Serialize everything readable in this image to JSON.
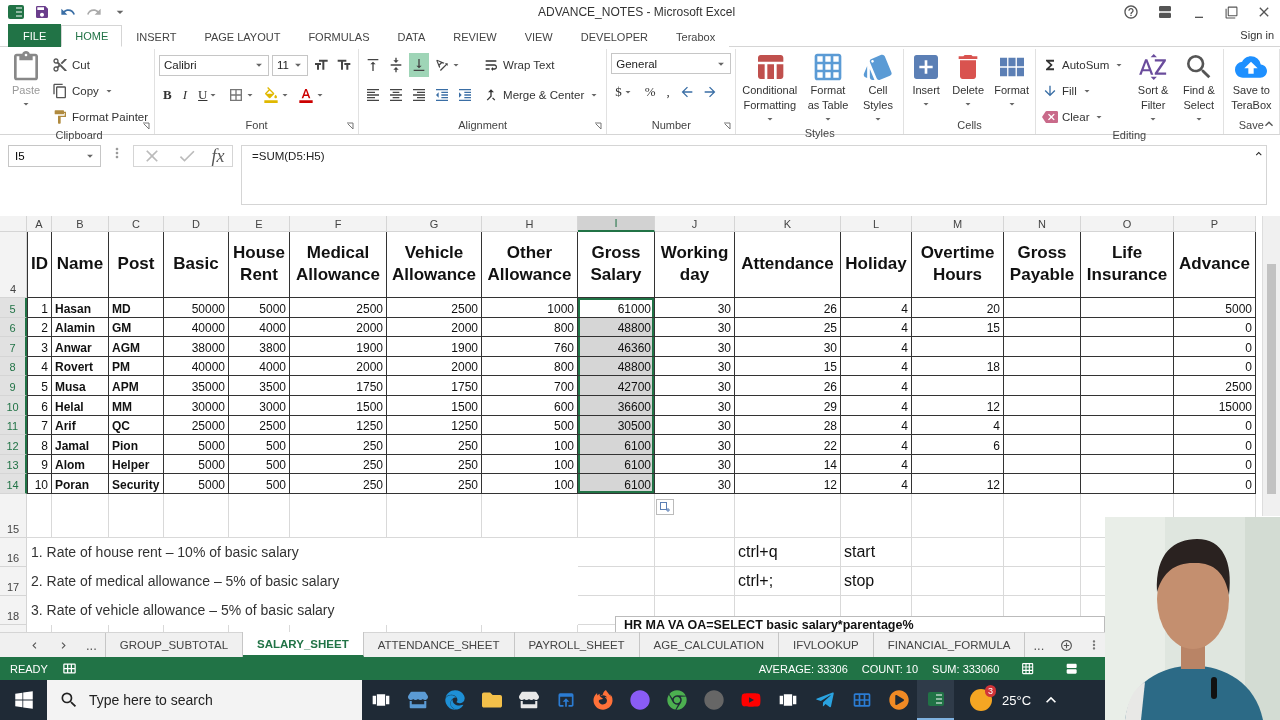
{
  "window": {
    "title": "ADVANCE_NOTES - Microsoft Excel",
    "sign_in": "Sign in"
  },
  "tabs": [
    {
      "label": "FILE",
      "selected": false,
      "kind": "file"
    },
    {
      "label": "HOME",
      "selected": true,
      "kind": "tab"
    },
    {
      "label": "INSERT",
      "selected": false,
      "kind": "tab"
    },
    {
      "label": "PAGE LAYOUT",
      "selected": false,
      "kind": "tab"
    },
    {
      "label": "FORMULAS",
      "selected": false,
      "kind": "tab"
    },
    {
      "label": "DATA",
      "selected": false,
      "kind": "tab"
    },
    {
      "label": "REVIEW",
      "selected": false,
      "kind": "tab"
    },
    {
      "label": "VIEW",
      "selected": false,
      "kind": "tab"
    },
    {
      "label": "DEVELOPER",
      "selected": false,
      "kind": "tab"
    },
    {
      "label": "Terabox",
      "selected": false,
      "kind": "tab"
    }
  ],
  "ribbon": [
    {
      "label": "Clipboard",
      "launcher": true,
      "columns": [
        [
          [
            {
              "kind": "large",
              "label": "Paste",
              "dropdown": true,
              "disabled": true
            }
          ]
        ],
        [
          [
            {
              "kind": "small",
              "label": "Cut"
            }
          ],
          [
            {
              "kind": "small",
              "label": "Copy",
              "dropdown": true
            }
          ],
          [
            {
              "kind": "small",
              "label": "Format Painter"
            }
          ]
        ]
      ]
    },
    {
      "label": "Font",
      "launcher": true,
      "columns": [
        [
          [
            {
              "kind": "field",
              "value": "Calibri"
            },
            {
              "kind": "field",
              "value": "11"
            },
            {
              "kind": "icon"
            },
            {
              "kind": "icon"
            }
          ],
          [
            {
              "kind": "glyph",
              "label": "B"
            },
            {
              "kind": "glyph",
              "label": "I"
            },
            {
              "kind": "glyph",
              "label": "U",
              "dropdown": true
            },
            {
              "kind": "icon",
              "dropdown": true
            },
            {
              "kind": "icon",
              "dropdown": true
            },
            {
              "kind": "icon",
              "dropdown": true
            }
          ]
        ]
      ]
    },
    {
      "label": "Alignment",
      "launcher": true,
      "columns": [
        [
          [
            {
              "kind": "icon",
              "selected": false
            },
            {
              "kind": "icon",
              "selected": false
            },
            {
              "kind": "icon",
              "selected": true
            },
            {
              "kind": "icon",
              "dropdown": true
            }
          ],
          [
            {
              "kind": "icon"
            },
            {
              "kind": "icon"
            },
            {
              "kind": "icon"
            },
            {
              "kind": "icon"
            },
            {
              "kind": "icon"
            }
          ]
        ],
        [
          [
            {
              "kind": "small",
              "label": "Wrap Text"
            }
          ],
          [
            {
              "kind": "small",
              "label": "Merge & Center",
              "dropdown": true
            }
          ]
        ]
      ]
    },
    {
      "label": "Number",
      "launcher": true,
      "columns": [
        [
          [
            {
              "kind": "field",
              "value": "General"
            }
          ],
          [
            {
              "kind": "glyph",
              "label": "$",
              "dropdown": true
            },
            {
              "kind": "glyph",
              "label": "%"
            },
            {
              "kind": "glyph",
              "label": ","
            },
            {
              "kind": "icon"
            },
            {
              "kind": "icon"
            }
          ]
        ]
      ]
    },
    {
      "label": "Styles",
      "launcher": false,
      "columns": [
        [
          [
            {
              "kind": "large",
              "label": "Conditional Formatting",
              "dropdown": true
            }
          ]
        ],
        [
          [
            {
              "kind": "large",
              "label": "Format as Table",
              "dropdown": true
            }
          ]
        ],
        [
          [
            {
              "kind": "large",
              "label": "Cell Styles",
              "dropdown": true
            }
          ]
        ]
      ]
    },
    {
      "label": "Cells",
      "launcher": false,
      "columns": [
        [
          [
            {
              "kind": "large",
              "label": "Insert",
              "dropdown": true
            }
          ]
        ],
        [
          [
            {
              "kind": "large",
              "label": "Delete",
              "dropdown": true
            }
          ]
        ],
        [
          [
            {
              "kind": "large",
              "label": "Format",
              "dropdown": true
            }
          ]
        ]
      ]
    },
    {
      "label": "Editing",
      "launcher": false,
      "columns": [
        [
          [
            {
              "kind": "small",
              "label": "AutoSum",
              "dropdown": true
            }
          ],
          [
            {
              "kind": "small",
              "label": "Fill",
              "dropdown": true
            }
          ],
          [
            {
              "kind": "small",
              "label": "Clear",
              "dropdown": true
            }
          ]
        ],
        [
          [
            {
              "kind": "large",
              "label": "Sort & Filter",
              "dropdown": true
            }
          ]
        ],
        [
          [
            {
              "kind": "large",
              "label": "Find & Select",
              "dropdown": true
            }
          ]
        ]
      ]
    },
    {
      "label": "Save",
      "launcher": false,
      "columns": [
        [
          [
            {
              "kind": "large",
              "label": "Save to TeraBox"
            }
          ]
        ]
      ]
    }
  ],
  "formula_bar": {
    "name_box": "I5",
    "function_label": "fx",
    "formula": "=SUM(D5:H5)"
  },
  "sheet": {
    "columns": [
      {
        "letter": "A",
        "selected": false,
        "kind": "number"
      },
      {
        "letter": "B",
        "selected": false,
        "kind": "label"
      },
      {
        "letter": "C",
        "selected": false,
        "kind": "label"
      },
      {
        "letter": "D",
        "selected": false,
        "kind": "number"
      },
      {
        "letter": "E",
        "selected": false,
        "kind": "number"
      },
      {
        "letter": "F",
        "selected": false,
        "kind": "number"
      },
      {
        "letter": "G",
        "selected": false,
        "kind": "number"
      },
      {
        "letter": "H",
        "selected": false,
        "kind": "number"
      },
      {
        "letter": "I",
        "selected": true,
        "kind": "number"
      },
      {
        "letter": "J",
        "selected": false,
        "kind": "number"
      },
      {
        "letter": "K",
        "selected": false,
        "kind": "number"
      },
      {
        "letter": "L",
        "selected": false,
        "kind": "number"
      },
      {
        "letter": "M",
        "selected": false,
        "kind": "number"
      },
      {
        "letter": "N",
        "selected": false,
        "kind": "number"
      },
      {
        "letter": "O",
        "selected": false,
        "kind": "number"
      },
      {
        "letter": "P",
        "selected": false,
        "kind": "number"
      }
    ],
    "header_row": {
      "row": "4",
      "cells": [
        "ID",
        "Name",
        "Post",
        "Basic",
        "House Rent",
        "Medical Allowance",
        "Vehicle Allowance",
        "Other Allowance",
        "Gross Salary",
        "Working day",
        "Attendance",
        "Holiday",
        "Overtime Hours",
        "Gross Payable",
        "Life Insurance",
        "Advance"
      ]
    },
    "rows": [
      {
        "row": "5",
        "selected": true,
        "active": true,
        "cells": [
          "1",
          "Hasan",
          "MD",
          "50000",
          "5000",
          "2500",
          "2500",
          "1000",
          "61000",
          "30",
          "26",
          "4",
          "20",
          null,
          null,
          "5000"
        ]
      },
      {
        "row": "6",
        "selected": true,
        "active": false,
        "cells": [
          "2",
          "Alamin",
          "GM",
          "40000",
          "4000",
          "2000",
          "2000",
          "800",
          "48800",
          "30",
          "25",
          "4",
          "15",
          null,
          null,
          "0"
        ]
      },
      {
        "row": "7",
        "selected": true,
        "active": false,
        "cells": [
          "3",
          "Anwar",
          "AGM",
          "38000",
          "3800",
          "1900",
          "1900",
          "760",
          "46360",
          "30",
          "30",
          "4",
          null,
          null,
          null,
          "0"
        ]
      },
      {
        "row": "8",
        "selected": true,
        "active": false,
        "cells": [
          "4",
          "Rovert",
          "PM",
          "40000",
          "4000",
          "2000",
          "2000",
          "800",
          "48800",
          "30",
          "15",
          "4",
          "18",
          null,
          null,
          "0"
        ]
      },
      {
        "row": "9",
        "selected": true,
        "active": false,
        "cells": [
          "5",
          "Musa",
          "APM",
          "35000",
          "3500",
          "1750",
          "1750",
          "700",
          "42700",
          "30",
          "26",
          "4",
          null,
          null,
          null,
          "2500"
        ]
      },
      {
        "row": "10",
        "selected": true,
        "active": false,
        "cells": [
          "6",
          "Helal",
          "MM",
          "30000",
          "3000",
          "1500",
          "1500",
          "600",
          "36600",
          "30",
          "29",
          "4",
          "12",
          null,
          null,
          "15000"
        ]
      },
      {
        "row": "11",
        "selected": true,
        "active": false,
        "cells": [
          "7",
          "Arif",
          "QC",
          "25000",
          "2500",
          "1250",
          "1250",
          "500",
          "30500",
          "30",
          "28",
          "4",
          "4",
          null,
          null,
          "0"
        ]
      },
      {
        "row": "12",
        "selected": true,
        "active": false,
        "cells": [
          "8",
          "Jamal",
          "Pion",
          "5000",
          "500",
          "250",
          "250",
          "100",
          "6100",
          "30",
          "22",
          "4",
          "6",
          null,
          null,
          "0"
        ]
      },
      {
        "row": "13",
        "selected": true,
        "active": false,
        "cells": [
          "9",
          "Alom",
          "Helper",
          "5000",
          "500",
          "250",
          "250",
          "100",
          "6100",
          "30",
          "14",
          "4",
          null,
          null,
          null,
          "0"
        ]
      },
      {
        "row": "14",
        "selected": true,
        "active": false,
        "cells": [
          "10",
          "Poran",
          "Security",
          "5000",
          "500",
          "250",
          "250",
          "100",
          "6100",
          "30",
          "12",
          "4",
          "12",
          null,
          null,
          "0"
        ]
      }
    ],
    "empty_row": "15",
    "note_rows": [
      {
        "row": "16",
        "note": "1.  Rate of house rent – 10% of basic salary",
        "shortcut": "ctrl+q",
        "action": "start"
      },
      {
        "row": "17",
        "note": "2.  Rate of medical allowance – 5% of basic salary",
        "shortcut": "ctrl+;",
        "action": "stop"
      },
      {
        "row": "18",
        "note": "3.  Rate of vehicle allowance – 5% of basic salary"
      }
    ],
    "text_box": "HR MA VA OA=SELECT basic salary*parentage%"
  },
  "sheet_tabs": {
    "more_left": "...",
    "tabs": [
      {
        "label": "GROUP_SUBTOTAL",
        "selected": false
      },
      {
        "label": "SALARY_SHEET",
        "selected": true
      },
      {
        "label": "ATTENDANCE_SHEET",
        "selected": false
      },
      {
        "label": "PAYROLL_SHEET",
        "selected": false
      },
      {
        "label": "AGE_CALCULATION",
        "selected": false
      },
      {
        "label": "IFVLOOKUP",
        "selected": false
      },
      {
        "label": "FINANCIAL_FORMULA",
        "selected": false
      }
    ],
    "more_right": "..."
  },
  "status_bar": {
    "mode": "READY",
    "average": "AVERAGE: 33306",
    "count": "COUNT: 10",
    "sum": "SUM: 333060"
  },
  "taskbar": {
    "search_placeholder": "Type here to search",
    "weather_badge": "3",
    "temperature": "25°C"
  }
}
